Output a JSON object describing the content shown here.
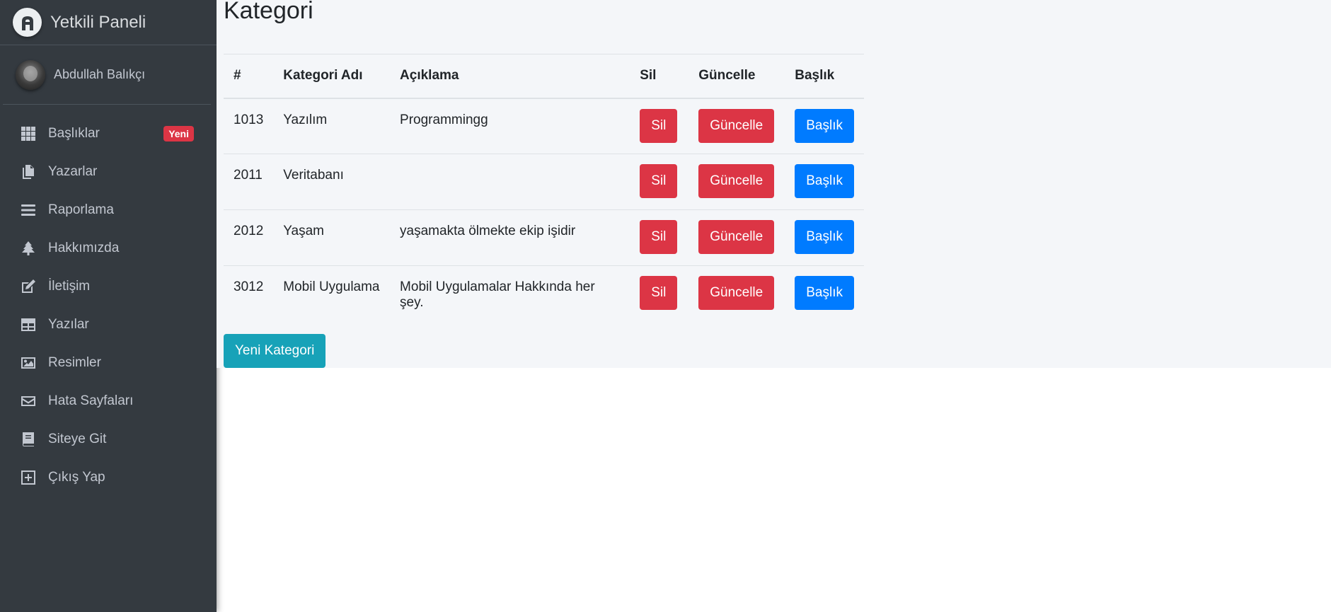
{
  "brand": {
    "title": "Yetkili Paneli"
  },
  "user": {
    "name": "Abdullah Balıkçı"
  },
  "sidebar": {
    "items": [
      {
        "label": "Başlıklar",
        "badge": "Yeni",
        "icon": "grid-icon"
      },
      {
        "label": "Yazarlar",
        "icon": "copy-icon"
      },
      {
        "label": "Raporlama",
        "icon": "bars-icon"
      },
      {
        "label": "Hakkımızda",
        "icon": "tree-icon"
      },
      {
        "label": "İletişim",
        "icon": "edit-icon"
      },
      {
        "label": "Yazılar",
        "icon": "table-icon"
      },
      {
        "label": "Resimler",
        "icon": "image-icon"
      },
      {
        "label": "Hata Sayfaları",
        "icon": "envelope-icon"
      },
      {
        "label": "Siteye Git",
        "icon": "book-icon"
      },
      {
        "label": "Çıkış Yap",
        "icon": "plus-square-icon"
      }
    ]
  },
  "page": {
    "title": "Kategori"
  },
  "table": {
    "headers": [
      "#",
      "Kategori Adı",
      "Açıklama",
      "Sil",
      "Güncelle",
      "Başlık"
    ],
    "rows": [
      {
        "id": "1013",
        "name": "Yazılım",
        "desc": "Programmingg",
        "sil": "Sil",
        "guncelle": "Güncelle",
        "baslik": "Başlık"
      },
      {
        "id": "2011",
        "name": "Veritabanı",
        "desc": "",
        "sil": "Sil",
        "guncelle": "Güncelle",
        "baslik": "Başlık"
      },
      {
        "id": "2012",
        "name": "Yaşam",
        "desc": "yaşamakta ölmekte ekip işidir",
        "sil": "Sil",
        "guncelle": "Güncelle",
        "baslik": "Başlık"
      },
      {
        "id": "3012",
        "name": "Mobil Uygulama",
        "desc": "Mobil Uygulamalar Hakkında her şey.",
        "sil": "Sil",
        "guncelle": "Güncelle",
        "baslik": "Başlık"
      }
    ]
  },
  "actions": {
    "new_category": "Yeni Kategori"
  },
  "colors": {
    "sidebar": "#343a40",
    "danger": "#dc3545",
    "primary": "#007bff",
    "info": "#17a2b8",
    "content_bg": "#f4f6f9"
  }
}
